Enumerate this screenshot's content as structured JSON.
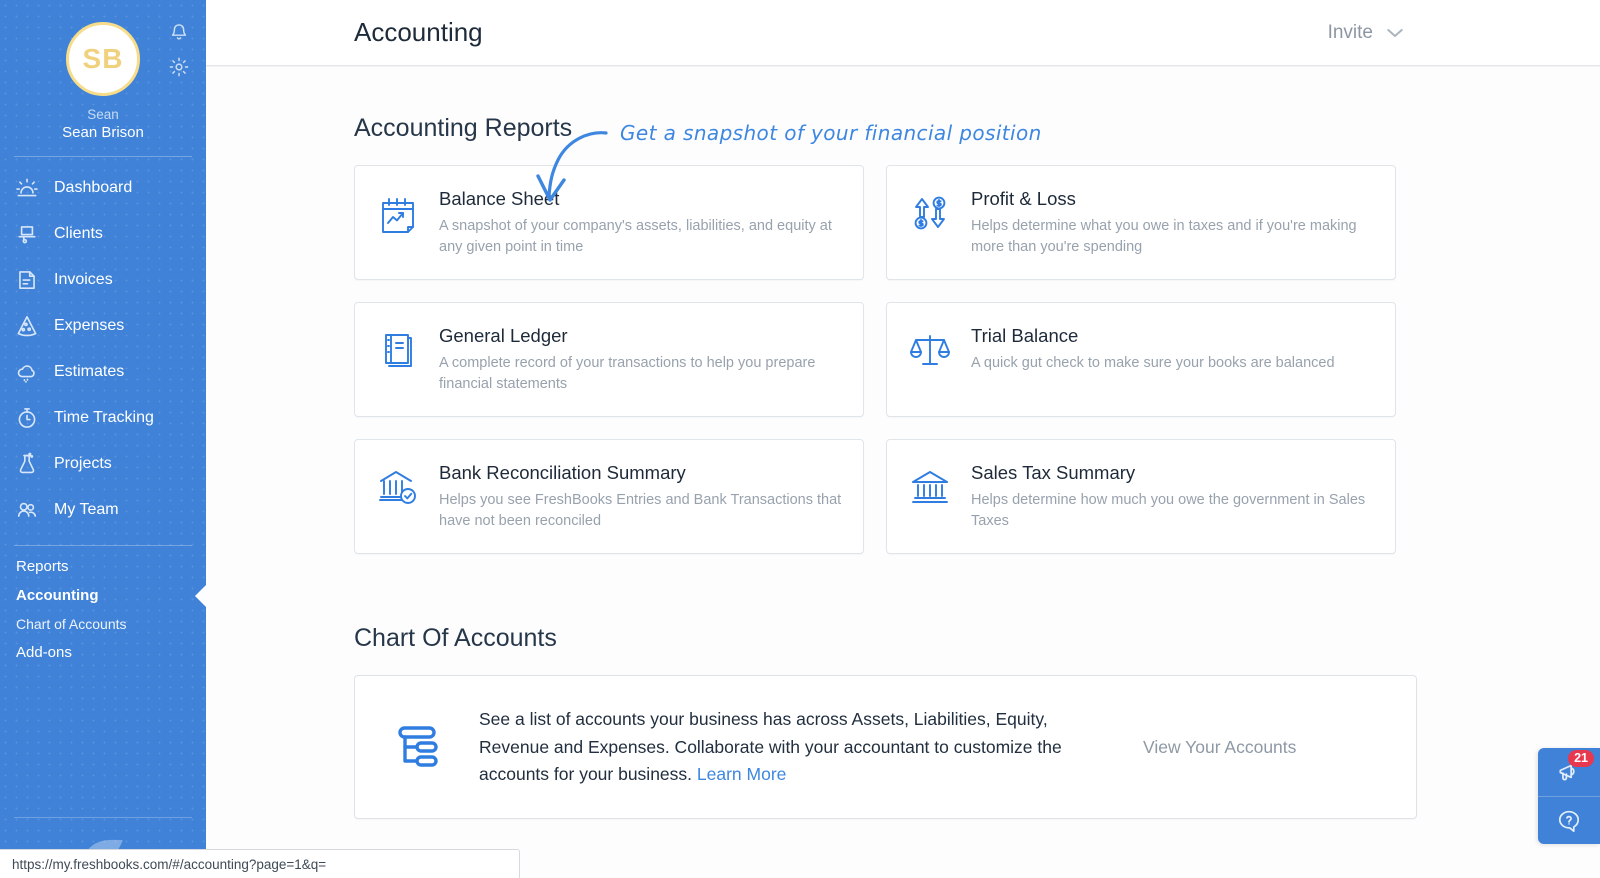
{
  "sidebar": {
    "avatar_initials": "SB",
    "user_first_name": "Sean",
    "user_full_name": "Sean Brison",
    "bell_icon": "bell-icon",
    "gear_icon": "gear-icon",
    "nav_items": [
      {
        "label": "Dashboard",
        "icon": "dashboard-sun-icon"
      },
      {
        "label": "Clients",
        "icon": "clients-icon"
      },
      {
        "label": "Invoices",
        "icon": "invoices-icon"
      },
      {
        "label": "Expenses",
        "icon": "expenses-pizza-icon"
      },
      {
        "label": "Estimates",
        "icon": "estimates-cloud-icon"
      },
      {
        "label": "Time Tracking",
        "icon": "stopwatch-icon"
      },
      {
        "label": "Projects",
        "icon": "flask-icon"
      },
      {
        "label": "My Team",
        "icon": "team-icon"
      }
    ],
    "sub_items": [
      {
        "label": "Reports",
        "active": false,
        "indent": false
      },
      {
        "label": "Accounting",
        "active": true,
        "indent": false
      },
      {
        "label": "Chart of Accounts",
        "active": false,
        "indent": true
      },
      {
        "label": "Add-ons",
        "active": false,
        "indent": false
      }
    ],
    "brand_logo": "freshbooks-leaf-logo"
  },
  "header": {
    "title": "Accounting",
    "invite_label": "Invite",
    "invite_chevron": "chevron-down-icon"
  },
  "main": {
    "reports_section_title": "Accounting Reports",
    "reports": [
      {
        "title": "Balance Sheet",
        "desc": "A snapshot of your company's assets, liabilities, and equity at any given point in time",
        "icon": "calendar-trend-icon"
      },
      {
        "title": "Profit & Loss",
        "desc": "Helps determine what you owe in taxes and if you're making more than you're spending",
        "icon": "arrows-dollar-icon"
      },
      {
        "title": "General Ledger",
        "desc": "A complete record of your transactions to help you prepare financial statements",
        "icon": "ledger-book-icon"
      },
      {
        "title": "Trial Balance",
        "desc": "A quick gut check to make sure your books are balanced",
        "icon": "scales-icon"
      },
      {
        "title": "Bank Reconciliation Summary",
        "desc": "Helps you see FreshBooks Entries and Bank Transactions that have not been reconciled",
        "icon": "bank-check-icon"
      },
      {
        "title": "Sales Tax Summary",
        "desc": "Helps determine how much you owe the government in Sales Taxes",
        "icon": "bank-icon"
      }
    ],
    "coa_section_title": "Chart Of Accounts",
    "coa": {
      "icon": "accounts-tree-icon",
      "text": "See a list of accounts your business has across Assets, Liabilities, Equity, Revenue and Expenses. Collaborate with your accountant to customize the accounts for your business.",
      "link_label": "Learn More",
      "cta_label": "View Your Accounts"
    }
  },
  "annotation": {
    "text": "Get a snapshot of your financial position",
    "color": "#3d87e0",
    "arrow": "curved-arrow-down-left"
  },
  "help_widget": {
    "announcements_icon": "megaphone-icon",
    "badge_count": "21",
    "help_icon": "question-bubble-icon",
    "badge_color": "#e8384f"
  },
  "status_bar": {
    "url": "https://my.freshbooks.com/#/accounting?page=1&q="
  },
  "colors": {
    "sidebar_blue": "#3f82d7",
    "accent_blue": "#2f7de1",
    "avatar_gold": "#f0d27e",
    "badge_red": "#e8384f"
  }
}
